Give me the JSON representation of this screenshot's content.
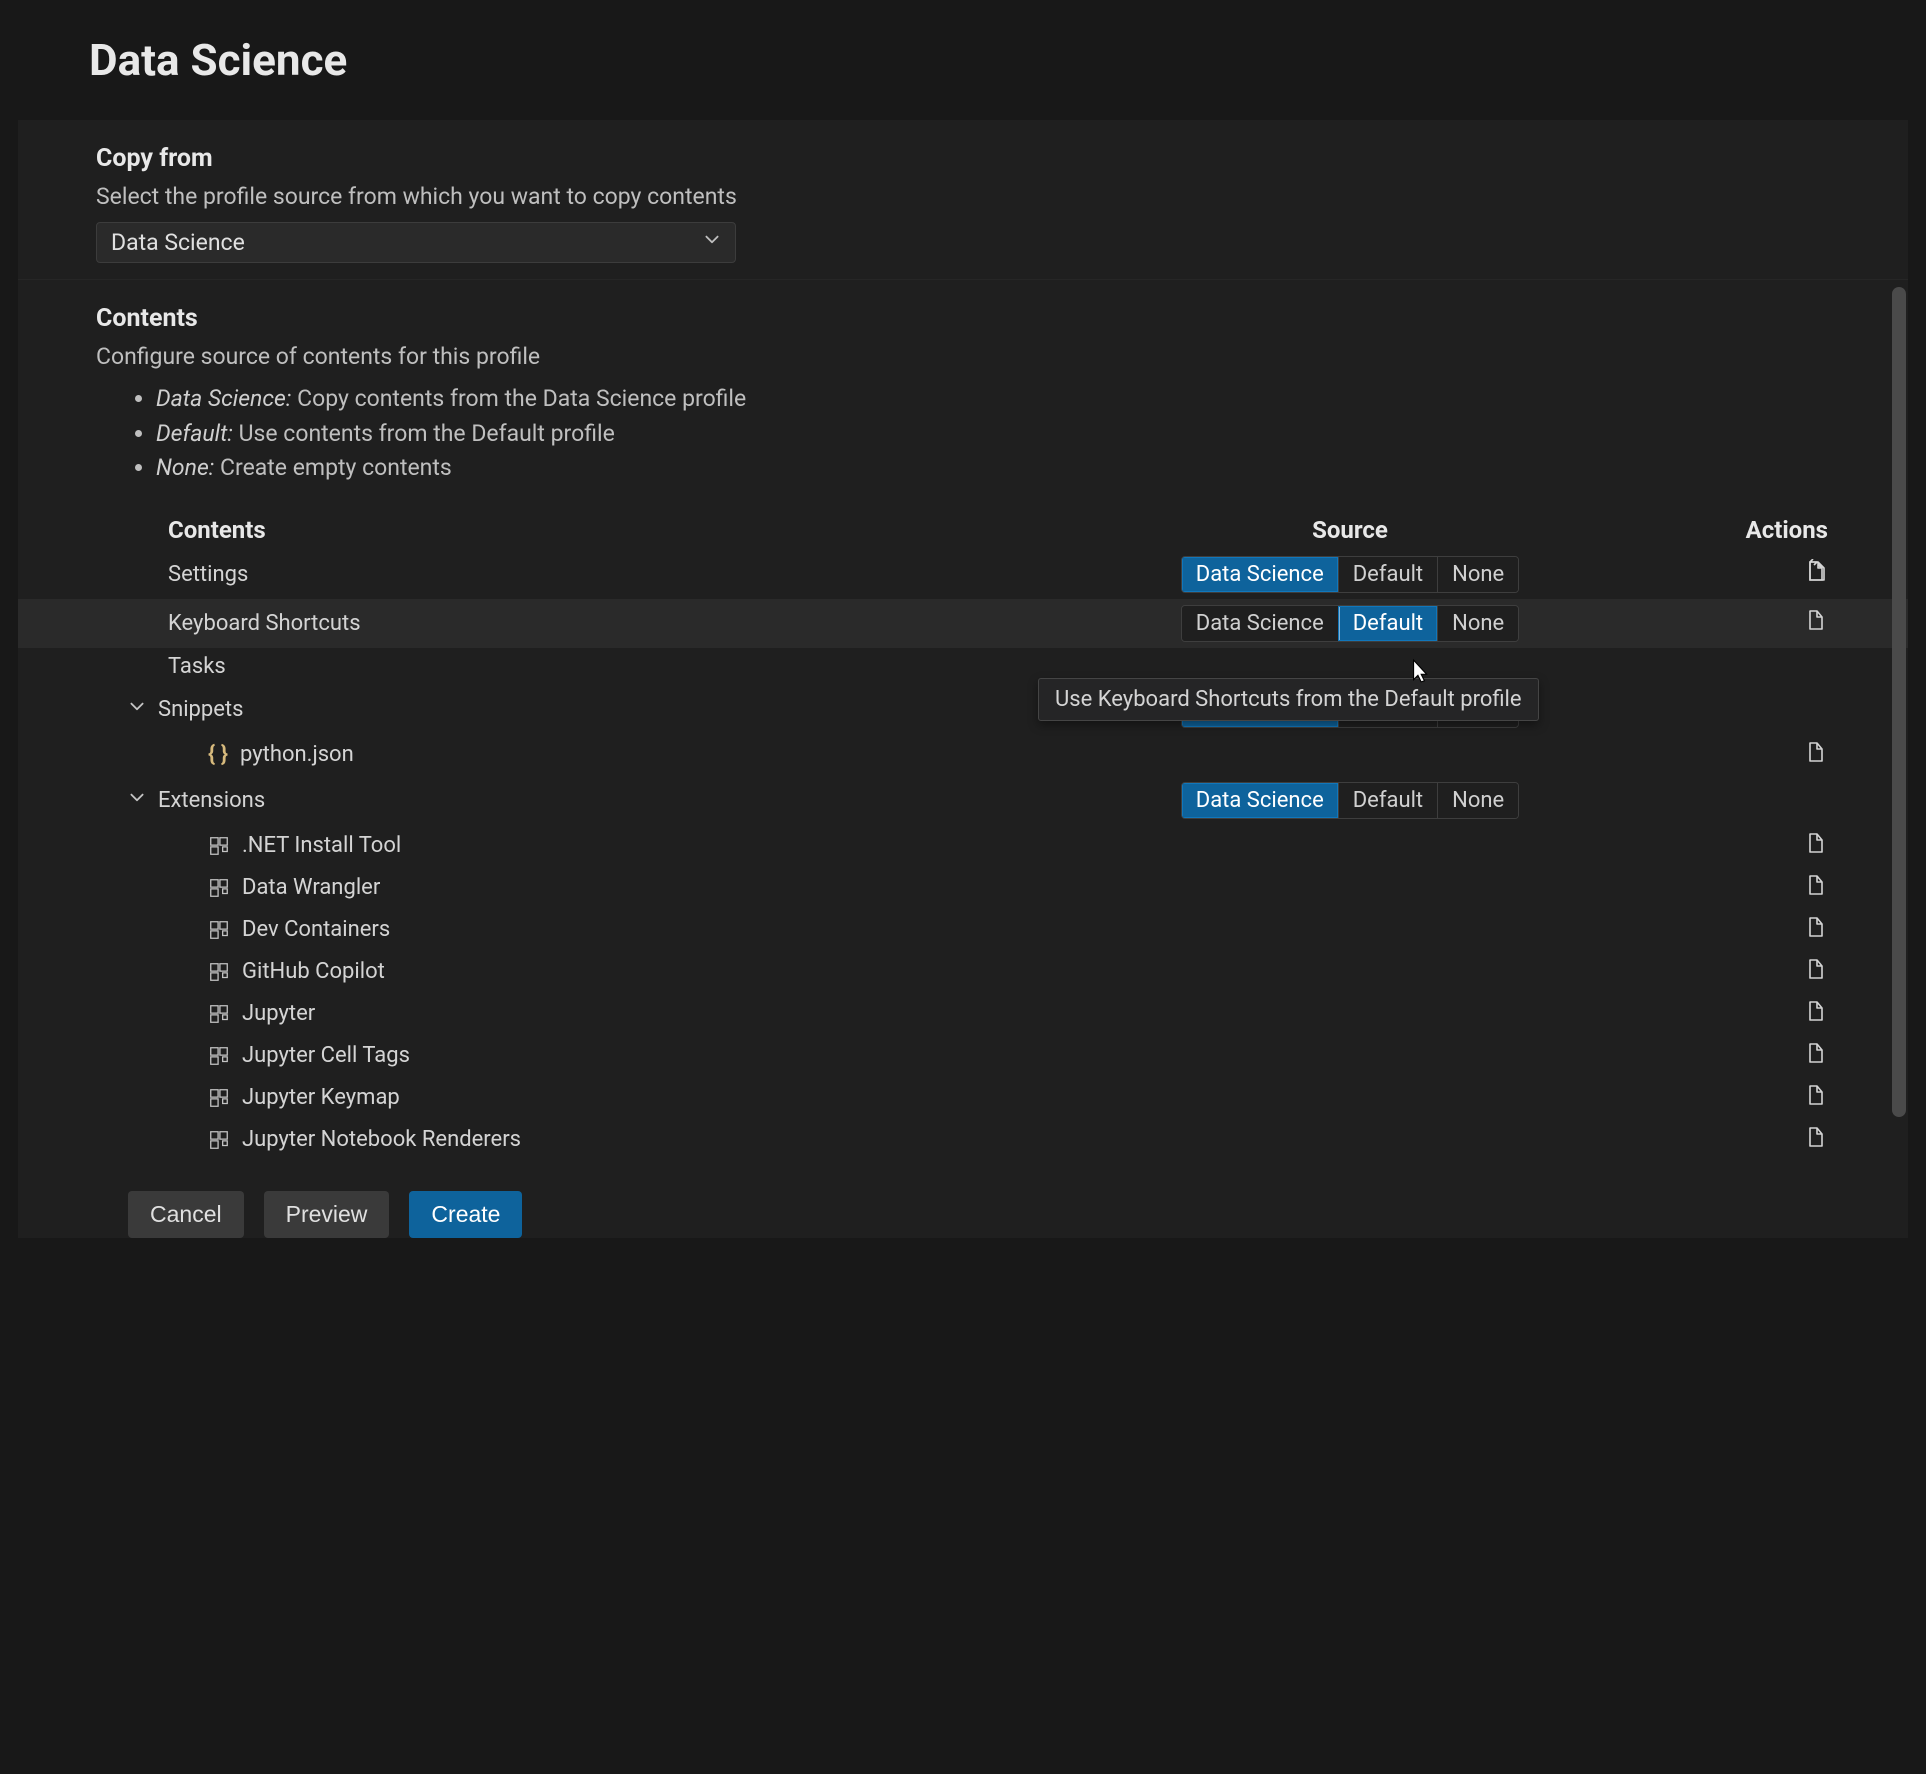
{
  "title": "Data Science",
  "copy_from": {
    "heading": "Copy from",
    "desc": "Select the profile source from which you want to copy contents",
    "selected": "Data Science"
  },
  "contents": {
    "heading": "Contents",
    "desc": "Configure source of contents for this profile",
    "bullets": [
      {
        "em": "Data Science:",
        "rest": " Copy contents from the Data Science profile"
      },
      {
        "em": "Default:",
        "rest": " Use contents from the Default profile"
      },
      {
        "em": "None:",
        "rest": " Create empty contents"
      }
    ],
    "columns": {
      "contents": "Contents",
      "source": "Source",
      "actions": "Actions"
    },
    "options": [
      "Data Science",
      "Default",
      "None"
    ],
    "rows": {
      "settings": {
        "label": "Settings",
        "active": 0,
        "has_action": true
      },
      "keyboard": {
        "label": "Keyboard Shortcuts",
        "active": 1,
        "has_action": true,
        "hover": true
      },
      "tasks": {
        "label": "Tasks"
      },
      "snippets": {
        "label": "Snippets",
        "active": 0,
        "expandable": true
      },
      "snippet_file": {
        "label": "python.json",
        "has_action": true
      },
      "extensions": {
        "label": "Extensions",
        "active": 0,
        "expandable": true
      },
      "ext_items": [
        ".NET Install Tool",
        "Data Wrangler",
        "Dev Containers",
        "GitHub Copilot",
        "Jupyter",
        "Jupyter Cell Tags",
        "Jupyter Keymap",
        "Jupyter Notebook Renderers"
      ]
    }
  },
  "tooltip": "Use Keyboard Shortcuts from the Default profile",
  "buttons": {
    "cancel": "Cancel",
    "preview": "Preview",
    "create": "Create"
  }
}
